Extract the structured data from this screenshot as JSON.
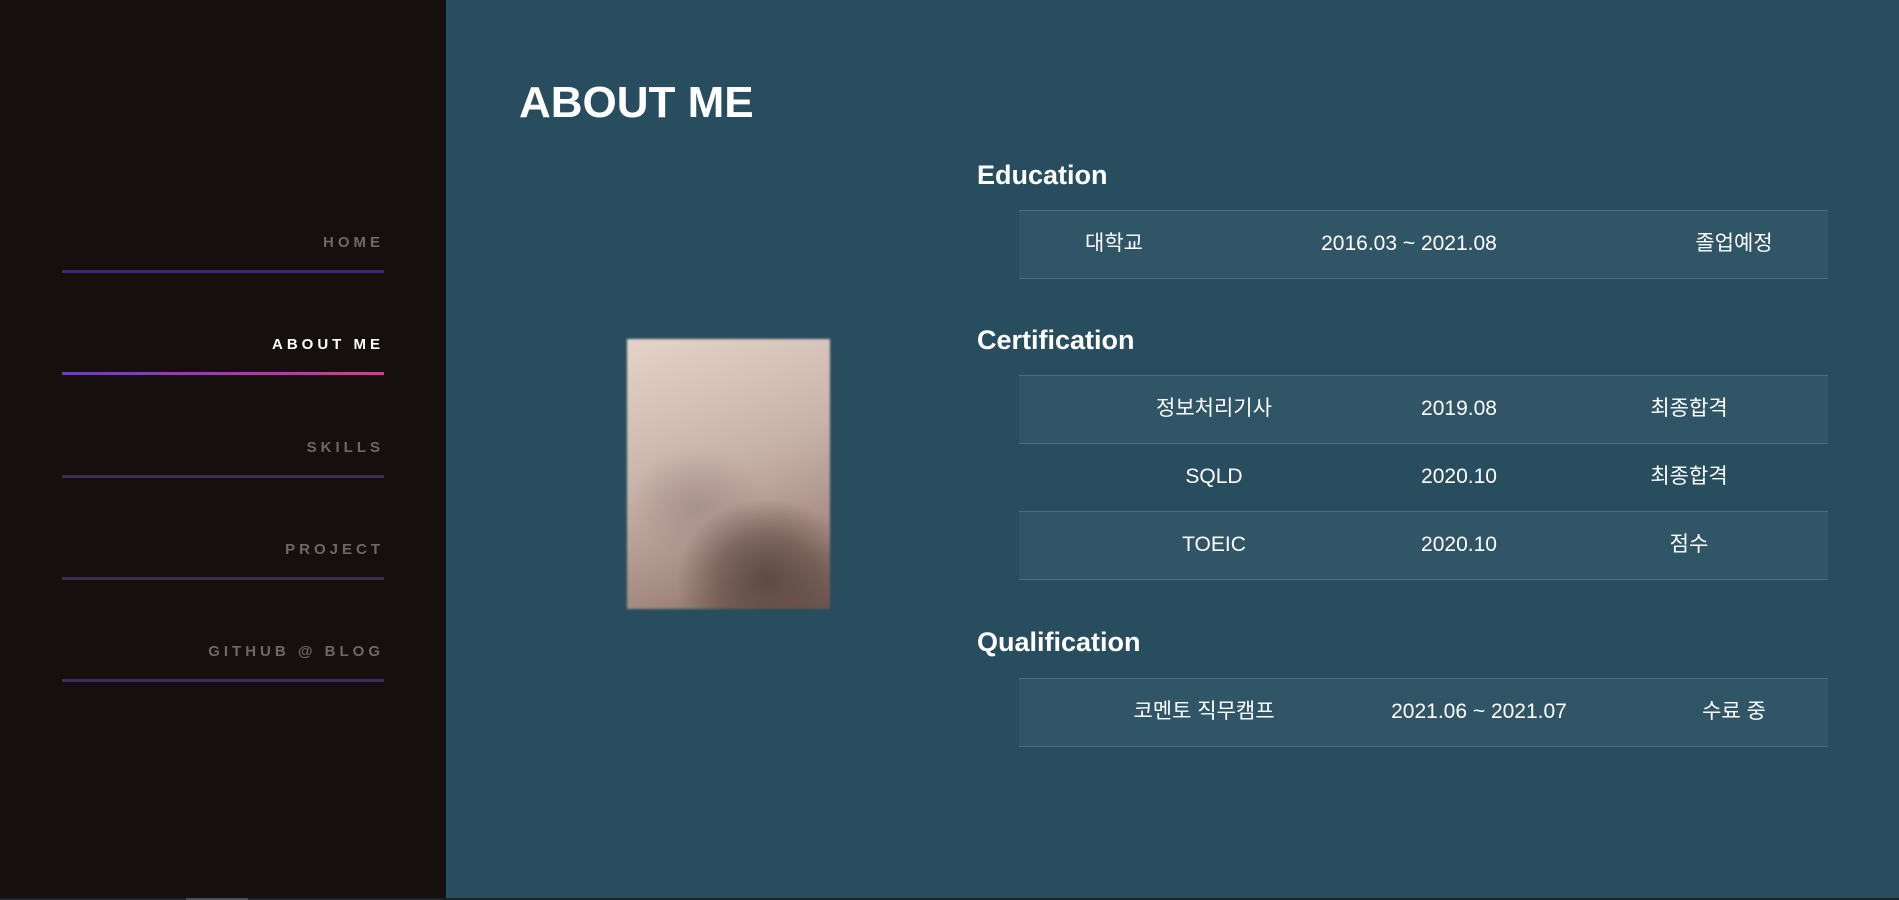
{
  "nav": {
    "items": [
      {
        "label": "HOME",
        "active": false
      },
      {
        "label": "ABOUT ME",
        "active": true
      },
      {
        "label": "SKILLS",
        "active": false
      },
      {
        "label": "PROJECT",
        "active": false
      },
      {
        "label": "GITHUB @ BLOG",
        "active": false
      }
    ],
    "colors": {
      "sidebar_bg": "#15100d",
      "inactive_text": "#6e6864",
      "active_text": "#ffffff",
      "line": "#3c2a6e",
      "active_line_gradient": [
        "#6c3fb4",
        "#c2478e"
      ]
    }
  },
  "main": {
    "title": "ABOUT ME",
    "bg_color": "#274d5f",
    "photo": {
      "icon": "profile-photo-blurred"
    },
    "education": {
      "title": "Education",
      "rows": [
        {
          "name": "대학교",
          "period": "2016.03 ~ 2021.08",
          "status": "졸업예정"
        }
      ]
    },
    "certification": {
      "title": "Certification",
      "rows": [
        {
          "name": "정보처리기사",
          "period": "2019.08",
          "status": "최종합격"
        },
        {
          "name": "SQLD",
          "period": "2020.10",
          "status": "최종합격"
        },
        {
          "name": "TOEIC",
          "period": "2020.10",
          "status": "점수"
        }
      ]
    },
    "qualification": {
      "title": "Qualification",
      "rows": [
        {
          "name": "코멘토 직무캠프",
          "period": "2021.06 ~ 2021.07",
          "status": "수료 중"
        }
      ]
    }
  }
}
